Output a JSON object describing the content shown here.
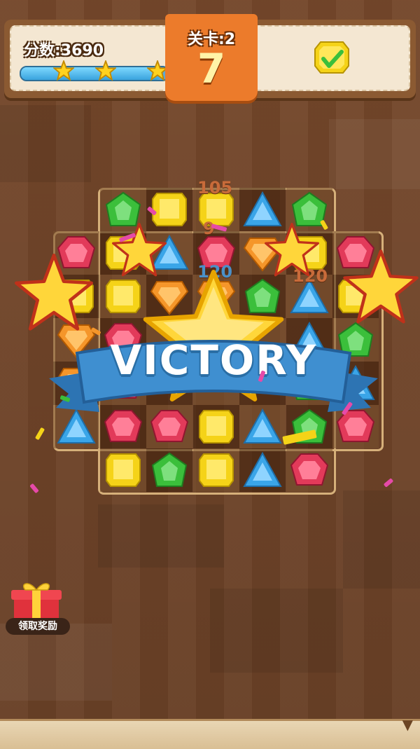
{
  "hud": {
    "score_label": "分数:3690",
    "progress": 0.95,
    "stars_earned": 3,
    "level_label": "关卡:2",
    "moves_left": "7",
    "goal_icon": "yellow-gem-check-icon"
  },
  "floating_scores": [
    "105",
    "9",
    "120",
    "120"
  ],
  "victory": {
    "text": "VICTORY"
  },
  "reward": {
    "label": "领取奖励",
    "icon": "gift-box-icon"
  },
  "colors": {
    "red": "#e23a5a",
    "yellow": "#f5d318",
    "green": "#3bbf3b",
    "blue": "#3aa5e8",
    "orange": "#f5962a",
    "accent_orange": "#ec7b2b",
    "ribbon_blue": "#3f8fd0"
  },
  "board": {
    "rows": [
      [
        "",
        "green",
        "yellow",
        "yellow",
        "blue",
        "green",
        ""
      ],
      [
        "red",
        "yellow",
        "blue",
        "red",
        "orange",
        "yellow",
        "red"
      ],
      [
        "yellow",
        "yellow",
        "orange",
        "orange",
        "green",
        "blue",
        "yellow"
      ],
      [
        "orange",
        "red",
        "",
        "",
        "",
        "blue",
        "green"
      ],
      [
        "orange",
        "red",
        "",
        "",
        "",
        "green",
        "blue"
      ],
      [
        "blue",
        "red",
        "red",
        "yellow",
        "blue",
        "green",
        "red"
      ],
      [
        "",
        "yellow",
        "green",
        "yellow",
        "blue",
        "red",
        ""
      ]
    ]
  }
}
